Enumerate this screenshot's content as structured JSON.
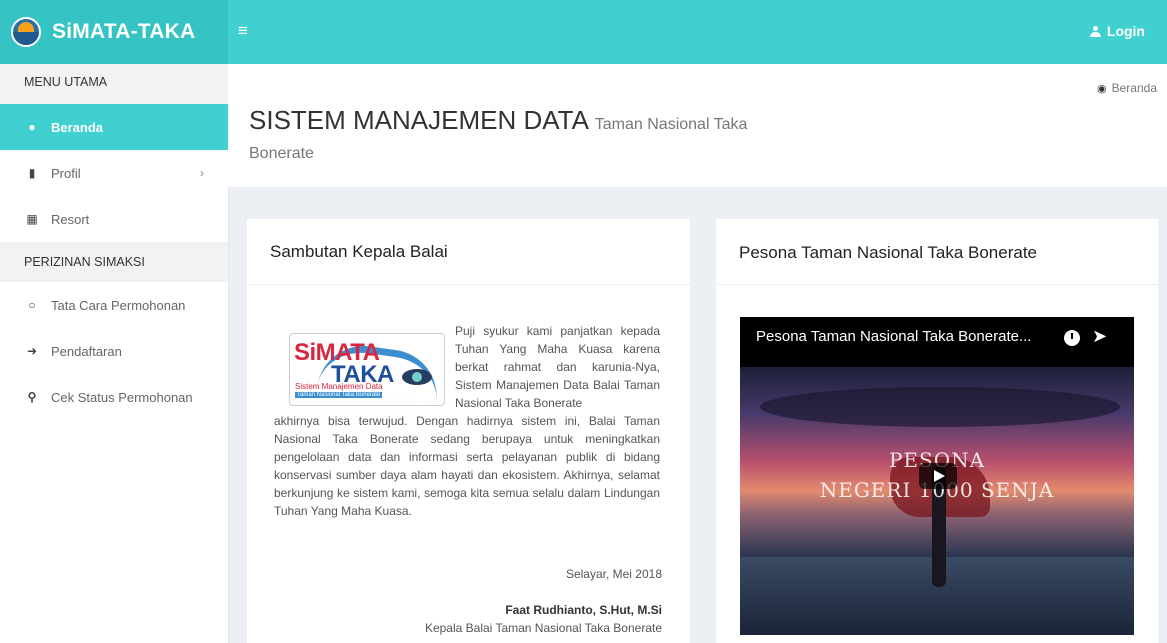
{
  "app": {
    "name": "SiMATA-TAKA",
    "login_label": "Login"
  },
  "sidebar": {
    "header_main": "MENU UTAMA",
    "items": [
      {
        "label": "Beranda",
        "icon": "dashboard-icon"
      },
      {
        "label": "Profil",
        "icon": "building-icon"
      },
      {
        "label": "Resort",
        "icon": "map-icon"
      }
    ],
    "header_permit": "PERIZINAN SIMAKSI",
    "permit_items": [
      {
        "label": "Tata Cara Permohonan",
        "icon": "circle-icon"
      },
      {
        "label": "Pendaftaran",
        "icon": "sign-in-icon"
      },
      {
        "label": "Cek Status Permohonan",
        "icon": "search-icon"
      }
    ]
  },
  "header": {
    "title": "SISTEM MANAJEMEN DATA",
    "subtitle_1": "Taman Nasional Taka",
    "subtitle_2": "Bonerate",
    "breadcrumb": "Beranda"
  },
  "welcome": {
    "title": "Sambutan Kepala Balai",
    "logo_text_1": "SiMATA",
    "logo_text_2": "TAKA",
    "logo_tag_1": "Sistem Manajemen Data",
    "logo_tag_2": "Taman Nasional Taka Bonerate",
    "paragraph_right": "Puji syukur kami panjatkan kepada Tuhan Yang Maha Kuasa karena berkat rahmat dan karunia-Nya, Sistem Manajemen Data Balai Taman Nasional Taka Bonerate",
    "paragraph": "akhirnya bisa terwujud. Dengan hadirnya sistem ini, Balai Taman Nasional Taka Bonerate sedang berupaya untuk meningkatkan pengelolaan data dan informasi serta pelayanan publik di bidang konservasi sumber daya alam hayati dan ekosistem. Akhirnya, selamat berkunjung ke sistem kami, semoga kita semua selalu dalam Lindungan Tuhan Yang Maha Kuasa.",
    "place_date": "Selayar, Mei 2018",
    "signer_name": "Faat Rudhianto, S.Hut, M.Si",
    "signer_title": "Kepala Balai Taman Nasional Taka Bonerate"
  },
  "video_box": {
    "title": "Pesona Taman Nasional Taka Bonerate",
    "video_title": "Pesona Taman Nasional Taka Bonerate...",
    "overlay_line_1": "PESONA",
    "overlay_line_2": "NEGERI 1000 SENJA"
  }
}
